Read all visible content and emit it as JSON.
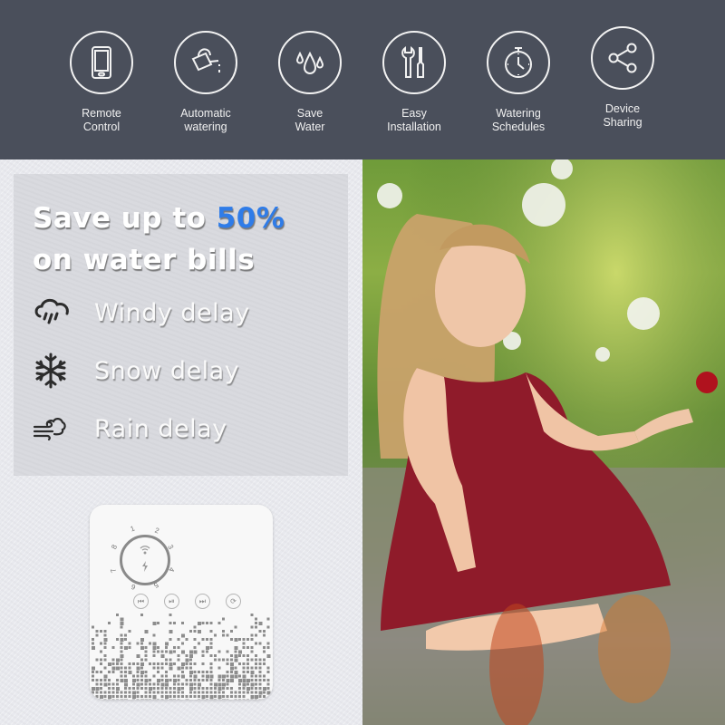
{
  "header": {
    "background": "#4a4f5b",
    "features": [
      {
        "icon": "smartphone-icon",
        "label_line1": "Remote",
        "label_line2": "Control"
      },
      {
        "icon": "watering-can-icon",
        "label_line1": "Automatic",
        "label_line2": "watering"
      },
      {
        "icon": "water-drops-icon",
        "label_line1": "Save",
        "label_line2": "Water"
      },
      {
        "icon": "wrench-screwdriver-icon",
        "label_line1": "Easy",
        "label_line2": "Installation"
      },
      {
        "icon": "stopwatch-icon",
        "label_line1": "Watering",
        "label_line2": "Schedules"
      },
      {
        "icon": "share-icon",
        "label_line1": "Device",
        "label_line2": "Sharing"
      }
    ]
  },
  "promo": {
    "headline_prefix": "Save up to ",
    "headline_highlight": "50%",
    "headline_line2": "on water bills",
    "highlight_color": "#2f7ce8",
    "delays": [
      {
        "icon": "cloud-rain-icon",
        "label": "Windy delay"
      },
      {
        "icon": "snowflake-icon",
        "label": "Snow delay"
      },
      {
        "icon": "wind-cloud-icon",
        "label": "Rain delay"
      }
    ]
  },
  "device": {
    "dial_numbers": [
      "1",
      "2",
      "3",
      "4",
      "5",
      "6",
      "7",
      "8"
    ],
    "buttons": [
      {
        "icon": "skip-back-icon",
        "glyph": "⏮"
      },
      {
        "icon": "play-pause-icon",
        "glyph": "⏯"
      },
      {
        "icon": "skip-forward-icon",
        "glyph": "⏭"
      },
      {
        "icon": "refresh-icon",
        "glyph": "⟳"
      }
    ]
  },
  "photo": {
    "description": "Girl in red dress sitting in garden holding a red rose"
  }
}
